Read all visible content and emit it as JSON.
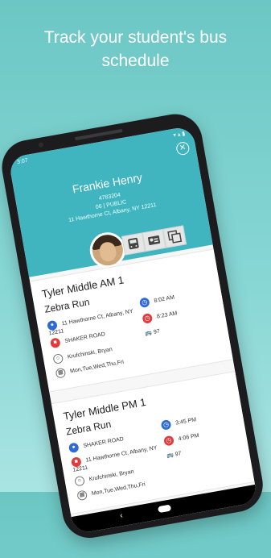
{
  "headline": {
    "line1": "Track your student's bus",
    "line2": "schedule"
  },
  "status_bar": {
    "time": "3:07",
    "system": "▾ ▴ ▮"
  },
  "student": {
    "name": "Frankie Henry",
    "id": "4783204",
    "grade_school": "06 | PUBLIC",
    "address": "11 Hawthorne Ct, Albany, NY 12211"
  },
  "tabs": [
    {
      "icon": "bus-icon"
    },
    {
      "icon": "id-card-icon"
    },
    {
      "icon": "copy-icon"
    }
  ],
  "routes": [
    {
      "route": "Tyler Middle AM 1",
      "run": "Zebra Run",
      "stop1": "11 Hawthorne Ct, Albany, NY 12211",
      "stop2": "SHAKER ROAD",
      "time1": "8:02 AM",
      "time2": "8:23 AM",
      "bus_number": "97",
      "driver": "Krufchinski, Bryan",
      "days": "Mon,Tue,Wed,Thu,Fri"
    },
    {
      "route": "Tyler Middle PM 1",
      "run": "Zebra Run",
      "stop1": "SHAKER ROAD",
      "stop2": "11 Hawthorne Ct, Albany, NY 12211",
      "time1": "3:45 PM",
      "time2": "4:06 PM",
      "bus_number": "97",
      "driver": "Krufchinski, Bryan",
      "days": "Mon,Tue,Wed,Thu,Fri"
    }
  ],
  "nav": {
    "back": "‹"
  },
  "colors": {
    "header": "#41b5bf",
    "blue": "#2f6bd6",
    "red": "#e33b3b"
  }
}
